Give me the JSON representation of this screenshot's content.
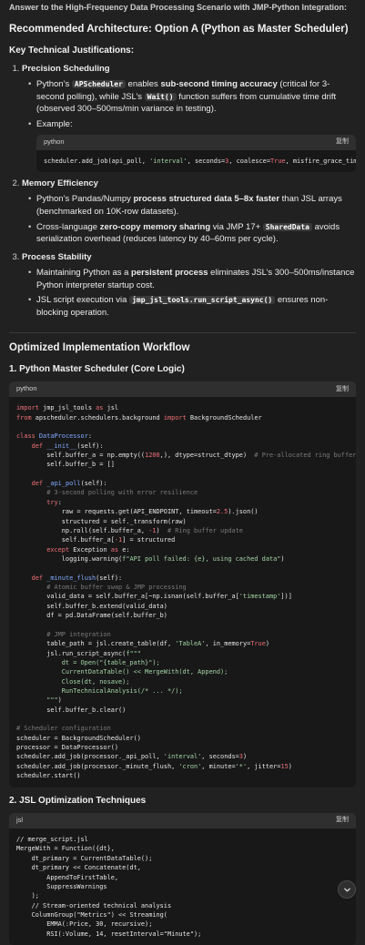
{
  "header": {
    "title": "Answer to the High-Frequency Data Processing Scenario with JMP-Python Integration:"
  },
  "recommend": {
    "heading": "Recommended Architecture: Option A (Python as Master Scheduler)",
    "subheading": "Key Technical Justifications:"
  },
  "sections": [
    {
      "title": "Precision Scheduling",
      "b1": {
        "t1": "Python’s ",
        "code": "APScheduler",
        "t2": " enables ",
        "bold": "sub-second timing accuracy",
        "t3": " (critical for 3-second polling), while JSL’s ",
        "code2": "Wait()",
        "t4": " function suffers from cumulative time drift (observed 300–500ms/min variance in testing)."
      },
      "b2": "Example:"
    },
    {
      "title": "Memory Efficiency",
      "b1": {
        "t1": "Python’s Pandas/Numpy ",
        "bold": "process structured data 5–8x faster",
        "t2": " than JSL arrays (benchmarked on 10K-row datasets)."
      },
      "b2": {
        "t1": "Cross-language ",
        "bold": "zero-copy memory sharing",
        "t2": " via JMP 17+ ",
        "code": "SharedData",
        "t3": " avoids serialization overhead (reduces latency by 40–60ms per cycle)."
      }
    },
    {
      "title": "Process Stability",
      "b1": {
        "t1": "Maintaining Python as a ",
        "bold": "persistent process",
        "t2": " eliminates JSL’s 300–500ms/instance Python interpreter startup cost."
      },
      "b2": {
        "t1": "JSL script execution via ",
        "code": "jmp_jsl_tools.run_script_async()",
        "t2": " ensures non-blocking operation."
      }
    }
  ],
  "code_blocks": [
    {
      "lang": "python",
      "copy": "复制"
    },
    {
      "lang": "python",
      "copy": "复制"
    },
    {
      "lang": "jsl",
      "copy": "复制"
    }
  ],
  "workflow": {
    "heading": "Optimized Implementation Workflow",
    "step1": "1. Python Master Scheduler (Core Logic)",
    "step2": "2. JSL Optimization Techniques"
  },
  "icons": {
    "scroll": "chevron-down-icon",
    "copy": "copy-icon"
  },
  "colors": {
    "background": "#212121",
    "code_bg": "#181818",
    "code_header": "#2f2f2f",
    "keyword": "#f07178",
    "string": "#a5d6a7",
    "comment": "#7a7a7a"
  }
}
